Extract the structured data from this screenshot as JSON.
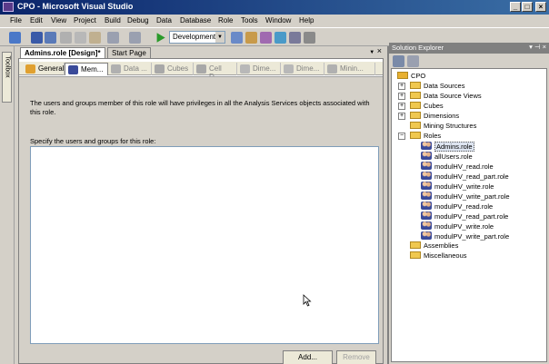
{
  "window": {
    "title": "CPO - Microsoft Visual Studio",
    "min": "_",
    "max": "□",
    "close": "×"
  },
  "menu": [
    "File",
    "Edit",
    "View",
    "Project",
    "Build",
    "Debug",
    "Data",
    "Database",
    "Role",
    "Tools",
    "Window",
    "Help"
  ],
  "toolbar": {
    "configuration": "Development"
  },
  "toolbox": {
    "label": "Toolbox"
  },
  "doc_tabs": {
    "active": "Admins.role [Design]*",
    "other": "Start Page",
    "pin": "▼",
    "close": "×"
  },
  "role_tabs": [
    "General",
    "Mem...",
    "Data ...",
    "Cubes",
    "Cell D...",
    "Dime...",
    "Dime...",
    "Minin..."
  ],
  "membership": {
    "description": "The users and groups member of this role will have privileges in all the Analysis Services objects associated with this role.",
    "specify_label": "Specify the users and groups for this role:",
    "add_button": "Add...",
    "remove_button": "Remove"
  },
  "solution_explorer": {
    "title": "Solution Explorer",
    "root": "CPO",
    "folders": [
      "Data Sources",
      "Data Source Views",
      "Cubes",
      "Dimensions",
      "Mining Structures",
      "Roles"
    ],
    "roles": [
      "Admins.role",
      "allUsers.role",
      "modulHV_read.role",
      "modulHV_read_part.role",
      "modulHV_write.role",
      "modulHV_write_part.role",
      "modulPV_read.role",
      "modulPV_read_part.role",
      "modulPV_write.role",
      "modulPV_write_part.role"
    ],
    "other_folders": [
      "Assemblies",
      "Miscellaneous"
    ]
  }
}
